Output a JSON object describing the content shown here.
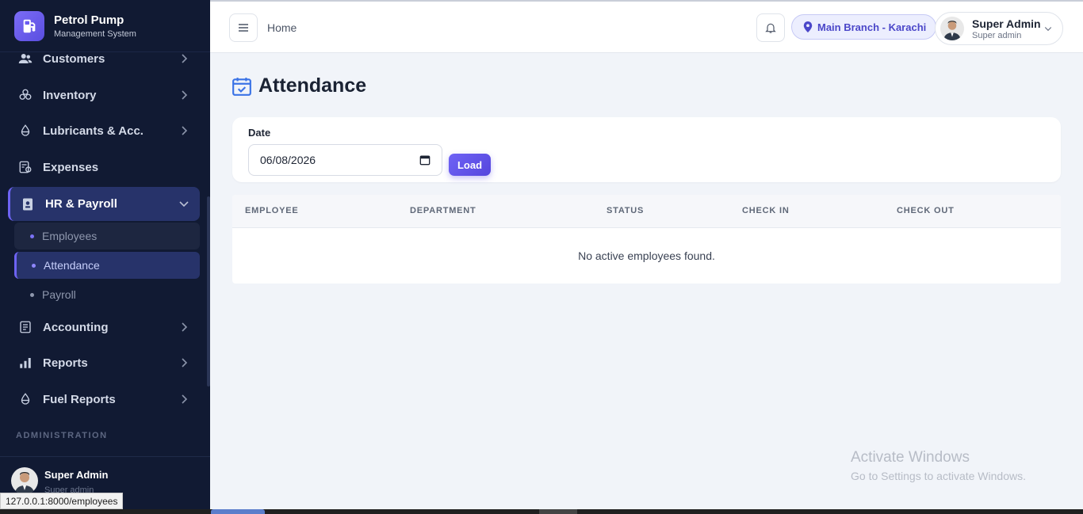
{
  "brand": {
    "title": "Petrol Pump",
    "subtitle": "Management System"
  },
  "topbar": {
    "breadcrumb": "Home",
    "branch": "Main Branch - Karachi",
    "user_name": "Super Admin",
    "user_role": "Super admin"
  },
  "sidebar": {
    "items": [
      {
        "label": "Customers",
        "icon": "users-icon"
      },
      {
        "label": "Inventory",
        "icon": "boxes-icon"
      },
      {
        "label": "Lubricants & Acc.",
        "icon": "droplet-icon"
      },
      {
        "label": "Expenses",
        "icon": "receipt-icon"
      },
      {
        "label": "HR & Payroll",
        "icon": "id-badge-icon"
      },
      {
        "label": "Accounting",
        "icon": "ledger-icon"
      },
      {
        "label": "Reports",
        "icon": "bar-chart-icon"
      },
      {
        "label": "Fuel Reports",
        "icon": "fuel-drop-icon"
      }
    ],
    "hr_sub": [
      "Employees",
      "Attendance",
      "Payroll"
    ],
    "section_label": "ADMINISTRATION",
    "user_name": "Super Admin",
    "user_role": "Super admin"
  },
  "page": {
    "title": "Attendance"
  },
  "filter": {
    "date_label": "Date",
    "date_value": "06/08/2026",
    "load_label": "Load"
  },
  "table": {
    "columns": [
      "EMPLOYEE",
      "DEPARTMENT",
      "STATUS",
      "CHECK IN",
      "CHECK OUT"
    ],
    "empty": "No active employees found."
  },
  "status_url": "127.0.0.1:8000/employees",
  "watermark": {
    "line1": "Activate Windows",
    "line2": "Go to Settings to activate Windows."
  },
  "colors": {
    "sidebar_bg": "#111a33",
    "accent": "#6d63f2",
    "page_bg": "#f1f4f9"
  }
}
